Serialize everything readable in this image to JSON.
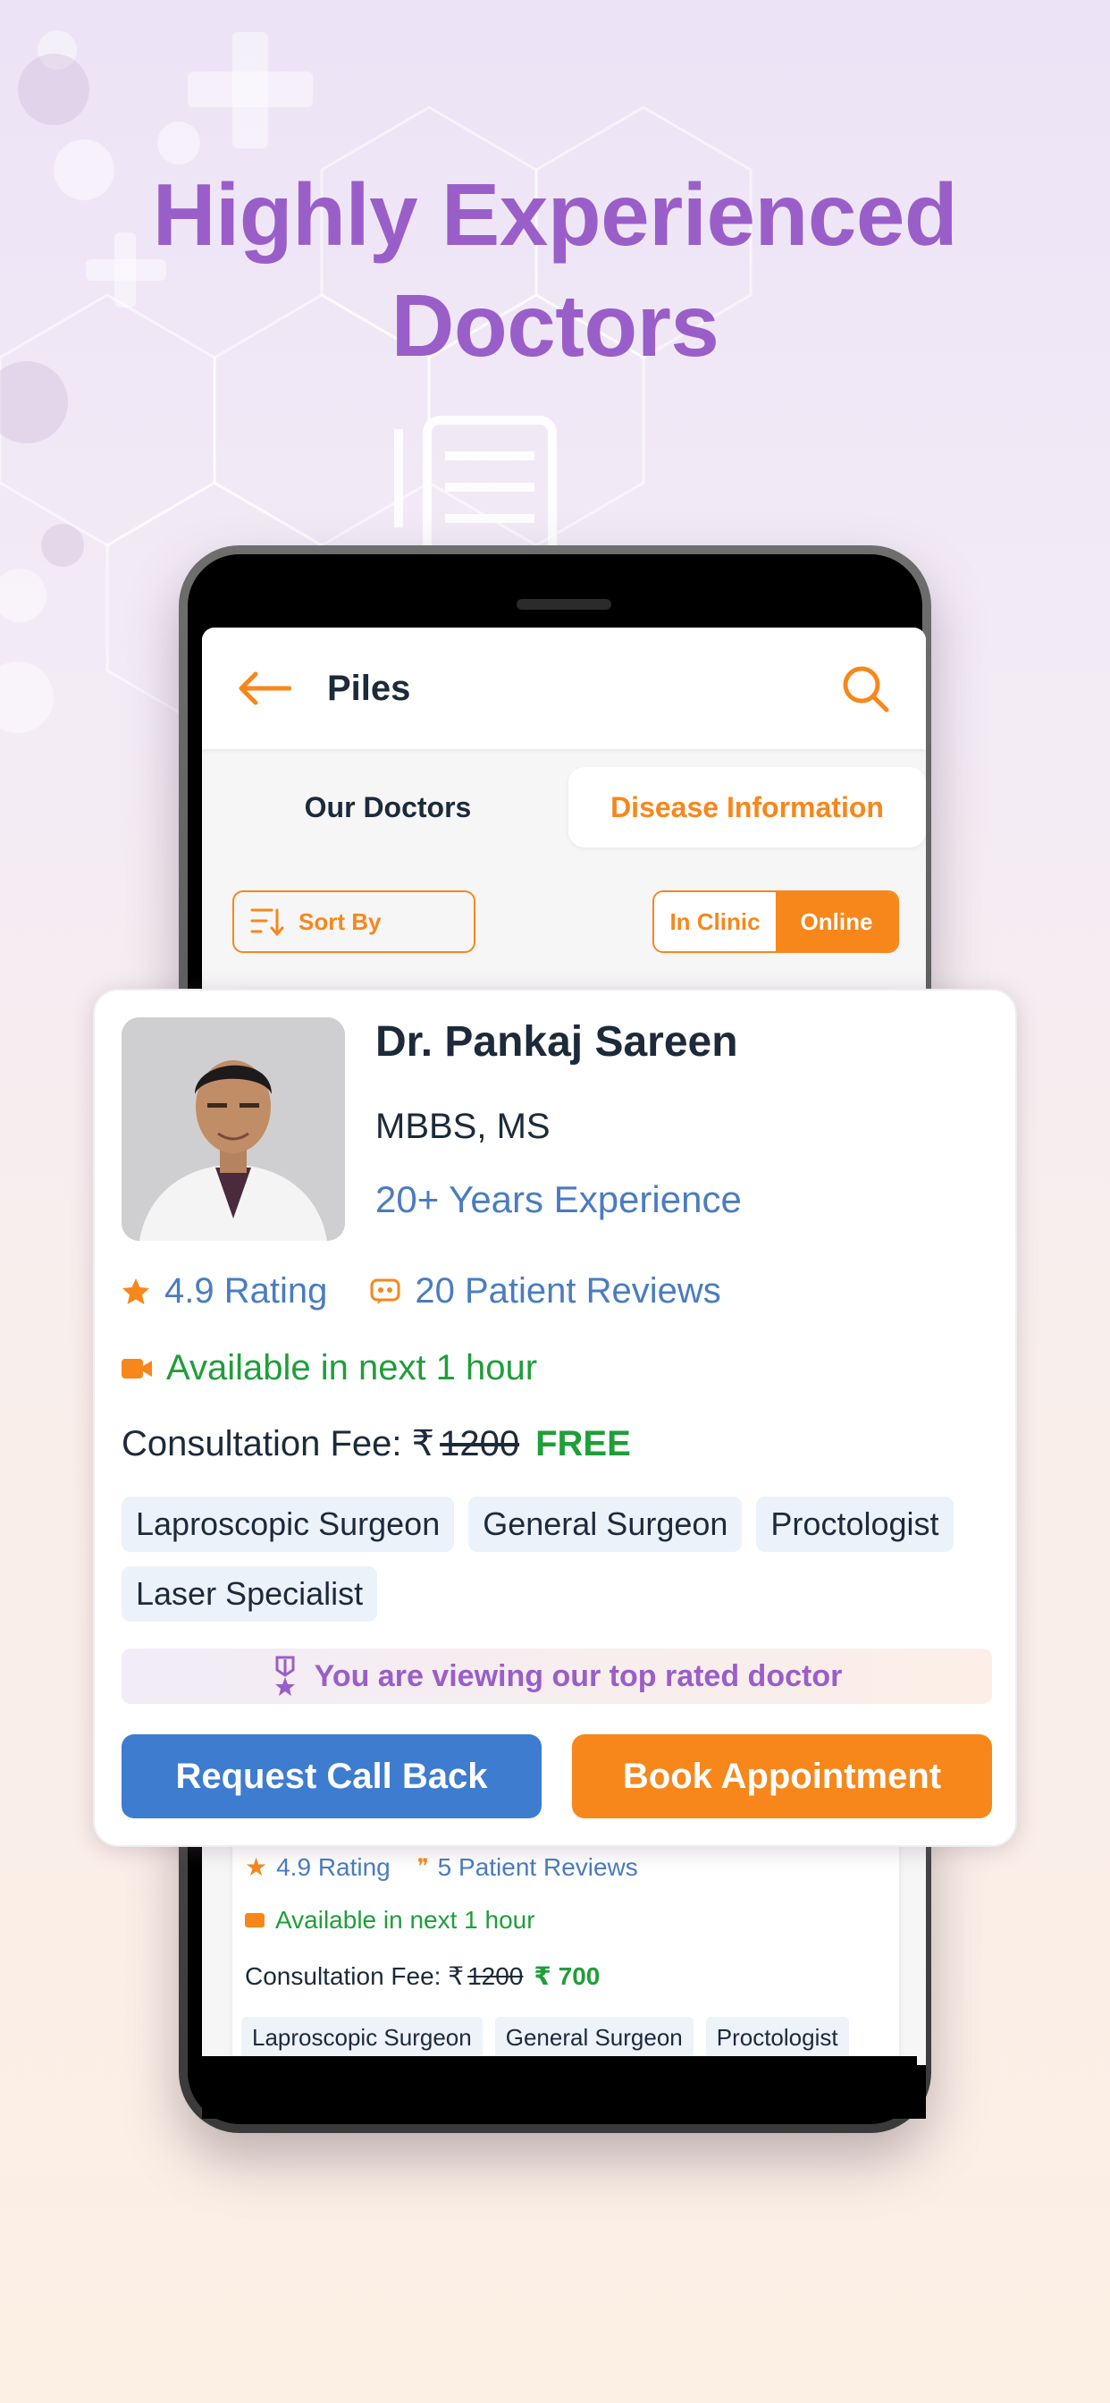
{
  "headline": {
    "line1": "Highly Experienced",
    "line2": "Doctors"
  },
  "appbar": {
    "title": "Piles",
    "back_icon": "arrow-left-icon",
    "search_icon": "search-icon"
  },
  "tabs": [
    {
      "label": "Our Doctors"
    },
    {
      "label": "Disease Information"
    }
  ],
  "filters": {
    "sort_label": "Sort By",
    "mode_options": [
      "In Clinic",
      "Online"
    ],
    "mode_selected": "Online"
  },
  "featured_doctor": {
    "name": "Dr. Pankaj Sareen",
    "degree": "MBBS, MS",
    "experience": "20+ Years Experience",
    "rating": "4.9 Rating",
    "reviews": "20 Patient Reviews",
    "availability": "Available in next 1 hour",
    "fee_label": "Consultation Fee: ₹",
    "fee_old": "1200",
    "fee_new": "FREE",
    "specialties": [
      "Laproscopic Surgeon",
      "General Surgeon",
      "Proctologist",
      "Laser Specialist"
    ],
    "banner": "You are viewing our top rated doctor",
    "buttons": {
      "call": "Request Call Back",
      "book": "Book Appointment"
    }
  },
  "list_doctor": {
    "rating": "4.9 Rating",
    "reviews": "5 Patient Reviews",
    "availability": "Available in next 1 hour",
    "fee_label": "Consultation Fee: ₹",
    "fee_old": "1200",
    "fee_new": "₹ 700",
    "specialties": [
      "Laproscopic Surgeon",
      "General Surgeon",
      "Proctologist"
    ]
  },
  "colors": {
    "accent_orange": "#f7871b",
    "headline_purple": "#9a5ec9",
    "call_blue": "#3d7ccf",
    "available_green": "#1f9e3a",
    "link_blue": "#4a7cc0"
  }
}
